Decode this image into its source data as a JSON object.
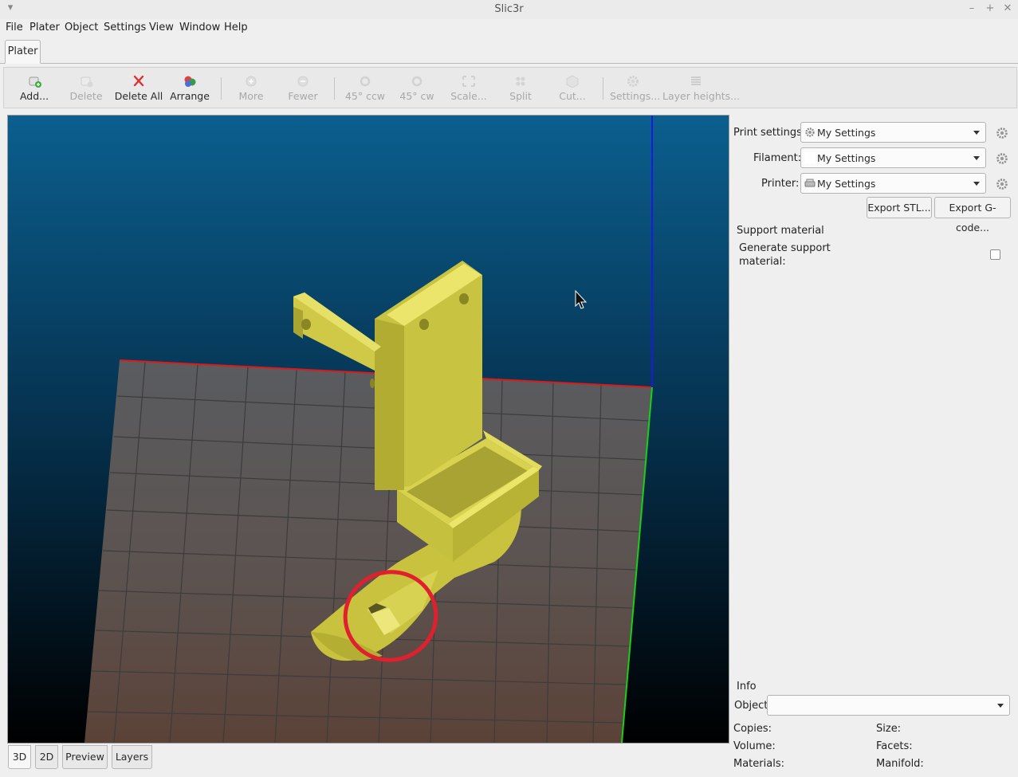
{
  "window": {
    "title": "Slic3r"
  },
  "menu": [
    "File",
    "Plater",
    "Object",
    "Settings",
    "View",
    "Window",
    "Help"
  ],
  "main_tab": "Plater",
  "toolbar": {
    "add": "Add...",
    "delete": "Delete",
    "delete_all": "Delete All",
    "arrange": "Arrange",
    "more": "More",
    "fewer": "Fewer",
    "rotate_ccw": "45° ccw",
    "rotate_cw": "45° cw",
    "scale": "Scale...",
    "split": "Split",
    "cut": "Cut...",
    "settings": "Settings...",
    "layer_heights": "Layer heights..."
  },
  "view_tabs": [
    "3D",
    "2D",
    "Preview",
    "Layers"
  ],
  "presets": {
    "print_label": "Print settings:",
    "print_value": "My Settings",
    "filament_label": "Filament:",
    "filament_value": "My Settings",
    "printer_label": "Printer:",
    "printer_value": "My Settings"
  },
  "export": {
    "stl": "Export STL...",
    "gcode": "Export G-code..."
  },
  "support": {
    "section_title": "Support material",
    "generate_label_line1": "Generate support",
    "generate_label_line2": "material:",
    "generate_checked": false
  },
  "info": {
    "section_title": "Info",
    "object_label": "Object:",
    "object_value": "",
    "copies_label": "Copies:",
    "size_label": "Size:",
    "volume_label": "Volume:",
    "facets_label": "Facets:",
    "materials_label": "Materials:",
    "manifold_label": "Manifold:"
  },
  "colors": {
    "model": "#d8d24e",
    "annotation_circle": "#e0202e",
    "x_axis": "#e01818",
    "y_axis": "#18d018",
    "z_axis": "#1a1ae0",
    "sky_top": "#0b5f8e",
    "sky_bottom": "#000000"
  }
}
